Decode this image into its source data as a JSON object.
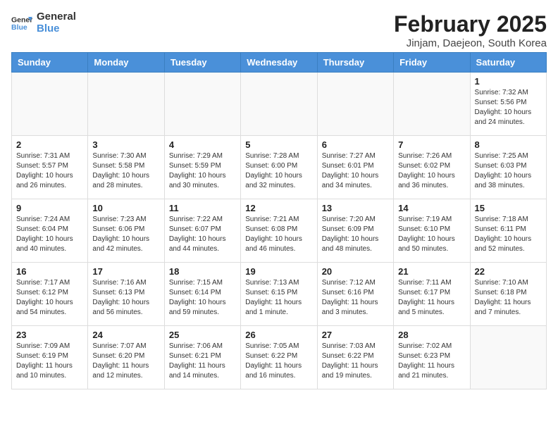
{
  "logo": {
    "line1": "General",
    "line2": "Blue"
  },
  "title": {
    "month_year": "February 2025",
    "location": "Jinjam, Daejeon, South Korea"
  },
  "weekdays": [
    "Sunday",
    "Monday",
    "Tuesday",
    "Wednesday",
    "Thursday",
    "Friday",
    "Saturday"
  ],
  "weeks": [
    [
      {
        "day": "",
        "info": ""
      },
      {
        "day": "",
        "info": ""
      },
      {
        "day": "",
        "info": ""
      },
      {
        "day": "",
        "info": ""
      },
      {
        "day": "",
        "info": ""
      },
      {
        "day": "",
        "info": ""
      },
      {
        "day": "1",
        "info": "Sunrise: 7:32 AM\nSunset: 5:56 PM\nDaylight: 10 hours and 24 minutes."
      }
    ],
    [
      {
        "day": "2",
        "info": "Sunrise: 7:31 AM\nSunset: 5:57 PM\nDaylight: 10 hours and 26 minutes."
      },
      {
        "day": "3",
        "info": "Sunrise: 7:30 AM\nSunset: 5:58 PM\nDaylight: 10 hours and 28 minutes."
      },
      {
        "day": "4",
        "info": "Sunrise: 7:29 AM\nSunset: 5:59 PM\nDaylight: 10 hours and 30 minutes."
      },
      {
        "day": "5",
        "info": "Sunrise: 7:28 AM\nSunset: 6:00 PM\nDaylight: 10 hours and 32 minutes."
      },
      {
        "day": "6",
        "info": "Sunrise: 7:27 AM\nSunset: 6:01 PM\nDaylight: 10 hours and 34 minutes."
      },
      {
        "day": "7",
        "info": "Sunrise: 7:26 AM\nSunset: 6:02 PM\nDaylight: 10 hours and 36 minutes."
      },
      {
        "day": "8",
        "info": "Sunrise: 7:25 AM\nSunset: 6:03 PM\nDaylight: 10 hours and 38 minutes."
      }
    ],
    [
      {
        "day": "9",
        "info": "Sunrise: 7:24 AM\nSunset: 6:04 PM\nDaylight: 10 hours and 40 minutes."
      },
      {
        "day": "10",
        "info": "Sunrise: 7:23 AM\nSunset: 6:06 PM\nDaylight: 10 hours and 42 minutes."
      },
      {
        "day": "11",
        "info": "Sunrise: 7:22 AM\nSunset: 6:07 PM\nDaylight: 10 hours and 44 minutes."
      },
      {
        "day": "12",
        "info": "Sunrise: 7:21 AM\nSunset: 6:08 PM\nDaylight: 10 hours and 46 minutes."
      },
      {
        "day": "13",
        "info": "Sunrise: 7:20 AM\nSunset: 6:09 PM\nDaylight: 10 hours and 48 minutes."
      },
      {
        "day": "14",
        "info": "Sunrise: 7:19 AM\nSunset: 6:10 PM\nDaylight: 10 hours and 50 minutes."
      },
      {
        "day": "15",
        "info": "Sunrise: 7:18 AM\nSunset: 6:11 PM\nDaylight: 10 hours and 52 minutes."
      }
    ],
    [
      {
        "day": "16",
        "info": "Sunrise: 7:17 AM\nSunset: 6:12 PM\nDaylight: 10 hours and 54 minutes."
      },
      {
        "day": "17",
        "info": "Sunrise: 7:16 AM\nSunset: 6:13 PM\nDaylight: 10 hours and 56 minutes."
      },
      {
        "day": "18",
        "info": "Sunrise: 7:15 AM\nSunset: 6:14 PM\nDaylight: 10 hours and 59 minutes."
      },
      {
        "day": "19",
        "info": "Sunrise: 7:13 AM\nSunset: 6:15 PM\nDaylight: 11 hours and 1 minute."
      },
      {
        "day": "20",
        "info": "Sunrise: 7:12 AM\nSunset: 6:16 PM\nDaylight: 11 hours and 3 minutes."
      },
      {
        "day": "21",
        "info": "Sunrise: 7:11 AM\nSunset: 6:17 PM\nDaylight: 11 hours and 5 minutes."
      },
      {
        "day": "22",
        "info": "Sunrise: 7:10 AM\nSunset: 6:18 PM\nDaylight: 11 hours and 7 minutes."
      }
    ],
    [
      {
        "day": "23",
        "info": "Sunrise: 7:09 AM\nSunset: 6:19 PM\nDaylight: 11 hours and 10 minutes."
      },
      {
        "day": "24",
        "info": "Sunrise: 7:07 AM\nSunset: 6:20 PM\nDaylight: 11 hours and 12 minutes."
      },
      {
        "day": "25",
        "info": "Sunrise: 7:06 AM\nSunset: 6:21 PM\nDaylight: 11 hours and 14 minutes."
      },
      {
        "day": "26",
        "info": "Sunrise: 7:05 AM\nSunset: 6:22 PM\nDaylight: 11 hours and 16 minutes."
      },
      {
        "day": "27",
        "info": "Sunrise: 7:03 AM\nSunset: 6:22 PM\nDaylight: 11 hours and 19 minutes."
      },
      {
        "day": "28",
        "info": "Sunrise: 7:02 AM\nSunset: 6:23 PM\nDaylight: 11 hours and 21 minutes."
      },
      {
        "day": "",
        "info": ""
      }
    ]
  ]
}
